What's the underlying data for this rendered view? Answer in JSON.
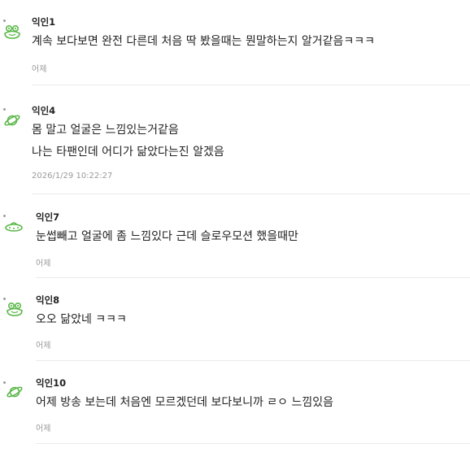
{
  "comments": [
    {
      "author": "익인1",
      "lines": [
        "계속 보다보면 완전 다른데 처음 딱 봤을때는 뭔말하는지 알거같음ㅋㅋㅋ"
      ],
      "time": "어제",
      "icon": "frog-icon"
    },
    {
      "author": "익인4",
      "lines": [
        "몸 말고 얼굴은 느낌있는거같음",
        "나는 타팬인데 어디가 닮았다는진 알겠음"
      ],
      "time": "2026/1/29 10:22:27",
      "icon": "planet-icon"
    },
    {
      "author": "익인7",
      "lines": [
        "눈썹빼고 얼굴에 좀 느낌있다 근데 슬로우모션 했을때만"
      ],
      "time": "어제",
      "icon": "ufo-icon"
    },
    {
      "author": "익인8",
      "lines": [
        "오오 닮았네 ㅋㅋㅋ"
      ],
      "time": "어제",
      "icon": "frog-icon"
    },
    {
      "author": "익인10",
      "lines": [
        "어제 방송 보는데 처음엔 모르겠던데 보다보니까 ㄹㅇ 느낌있음"
      ],
      "time": "어제",
      "icon": "planet-icon"
    }
  ],
  "colors": {
    "avatar_green": "#5cb84a",
    "text": "#222222",
    "meta": "#9a9a9a",
    "divider": "#eaeaea"
  }
}
